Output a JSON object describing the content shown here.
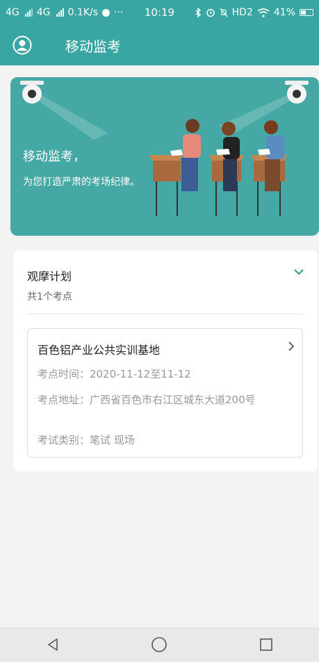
{
  "status_bar": {
    "sim1_label": "4G",
    "sim2_label": "4G",
    "net_speed": "0.1K/s",
    "dots": "···",
    "time": "10:19",
    "hd_label": "HD2",
    "battery_percent": "41%",
    "icons": [
      "bluetooth-icon",
      "alarm-icon",
      "mute-icon",
      "wifi-icon",
      "battery-icon"
    ]
  },
  "app_bar": {
    "title": "移动监考",
    "avatar_icon": "user-avatar-icon"
  },
  "banner": {
    "line1": "移动监考，",
    "line2": "为您打造严肃的考场纪律。"
  },
  "plan": {
    "title": "观摩计划",
    "count": "共1个考点",
    "expand_icon": "chevron-down-icon"
  },
  "site": {
    "name": "百色铝产业公共实训基地",
    "time_label": "考点时间：",
    "time_value": "2020-11-12至11-12",
    "address_label": "考点地址：",
    "address_value": "广西省百色市右江区城东大道200号",
    "type_label": "考试类别：",
    "type_value": "笔试 现场"
  },
  "colors": {
    "primary": "#3aa6a4",
    "banner_bg": "#46a8a4",
    "background": "#f3f3f3"
  }
}
